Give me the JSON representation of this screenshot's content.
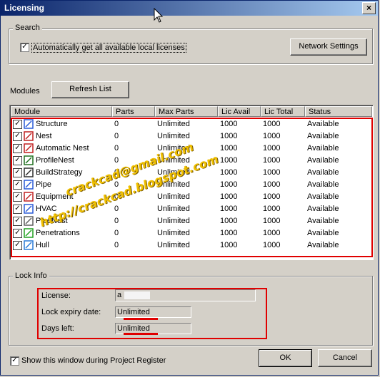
{
  "window": {
    "title": "Licensing",
    "close_label": "×"
  },
  "search": {
    "legend": "Search",
    "auto_label": "Automatically get all available local licenses",
    "auto_checked": true,
    "network_button": "Network Settings"
  },
  "modules": {
    "label": "Modules",
    "refresh_button": "Refresh List",
    "columns": [
      "Module",
      "Parts",
      "Max Parts",
      "Lic Avail",
      "Lic Total",
      "Status"
    ],
    "rows": [
      {
        "name": "Structure",
        "icon": "structure-icon",
        "parts": "0",
        "max": "Unlimited",
        "avail": "1000",
        "total": "1000",
        "status": "Available",
        "checked": true
      },
      {
        "name": "Nest",
        "icon": "nest-icon",
        "parts": "0",
        "max": "Unlimited",
        "avail": "1000",
        "total": "1000",
        "status": "Available",
        "checked": true
      },
      {
        "name": "Automatic Nest",
        "icon": "automatic-nest-icon",
        "parts": "0",
        "max": "Unlimited",
        "avail": "1000",
        "total": "1000",
        "status": "Available",
        "checked": true
      },
      {
        "name": "ProfileNest",
        "icon": "profile-nest-icon",
        "parts": "0",
        "max": "Unlimited",
        "avail": "1000",
        "total": "1000",
        "status": "Available",
        "checked": true
      },
      {
        "name": "BuildStrategy",
        "icon": "build-strategy-icon",
        "parts": "0",
        "max": "Unlimited",
        "avail": "1000",
        "total": "1000",
        "status": "Available",
        "checked": true
      },
      {
        "name": "Pipe",
        "icon": "pipe-icon",
        "parts": "0",
        "max": "Unlimited",
        "avail": "1000",
        "total": "1000",
        "status": "Available",
        "checked": true
      },
      {
        "name": "Equipment",
        "icon": "equipment-icon",
        "parts": "0",
        "max": "Unlimited",
        "avail": "1000",
        "total": "1000",
        "status": "Available",
        "checked": true
      },
      {
        "name": "HVAC",
        "icon": "hvac-icon",
        "parts": "0",
        "max": "Unlimited",
        "avail": "1000",
        "total": "1000",
        "status": "Available",
        "checked": true
      },
      {
        "name": "PipeNest",
        "icon": "pipe-nest-icon",
        "parts": "0",
        "max": "Unlimited",
        "avail": "1000",
        "total": "1000",
        "status": "Available",
        "checked": true
      },
      {
        "name": "Penetrations",
        "icon": "penetrations-icon",
        "parts": "0",
        "max": "Unlimited",
        "avail": "1000",
        "total": "1000",
        "status": "Available",
        "checked": true
      },
      {
        "name": "Hull",
        "icon": "hull-icon",
        "parts": "0",
        "max": "Unlimited",
        "avail": "1000",
        "total": "1000",
        "status": "Available",
        "checked": true
      }
    ]
  },
  "lock": {
    "legend": "Lock Info",
    "license_label": "License:",
    "license_value": "a",
    "expiry_label": "Lock expiry date:",
    "expiry_value": "Unlimited",
    "days_label": "Days left:",
    "days_value": "Unlimited"
  },
  "footer": {
    "show_label": "Show this window during Project Register",
    "show_checked": true,
    "ok_button": "OK",
    "cancel_button": "Cancel"
  },
  "watermark": {
    "line1": "crackcad@gmail.com",
    "line2": "http://crackcad.blogspot.com"
  },
  "colors": {
    "title_start": "#0a246a",
    "title_end": "#a6caf0",
    "highlight": "#e00000",
    "watermark": "#f0c000"
  }
}
